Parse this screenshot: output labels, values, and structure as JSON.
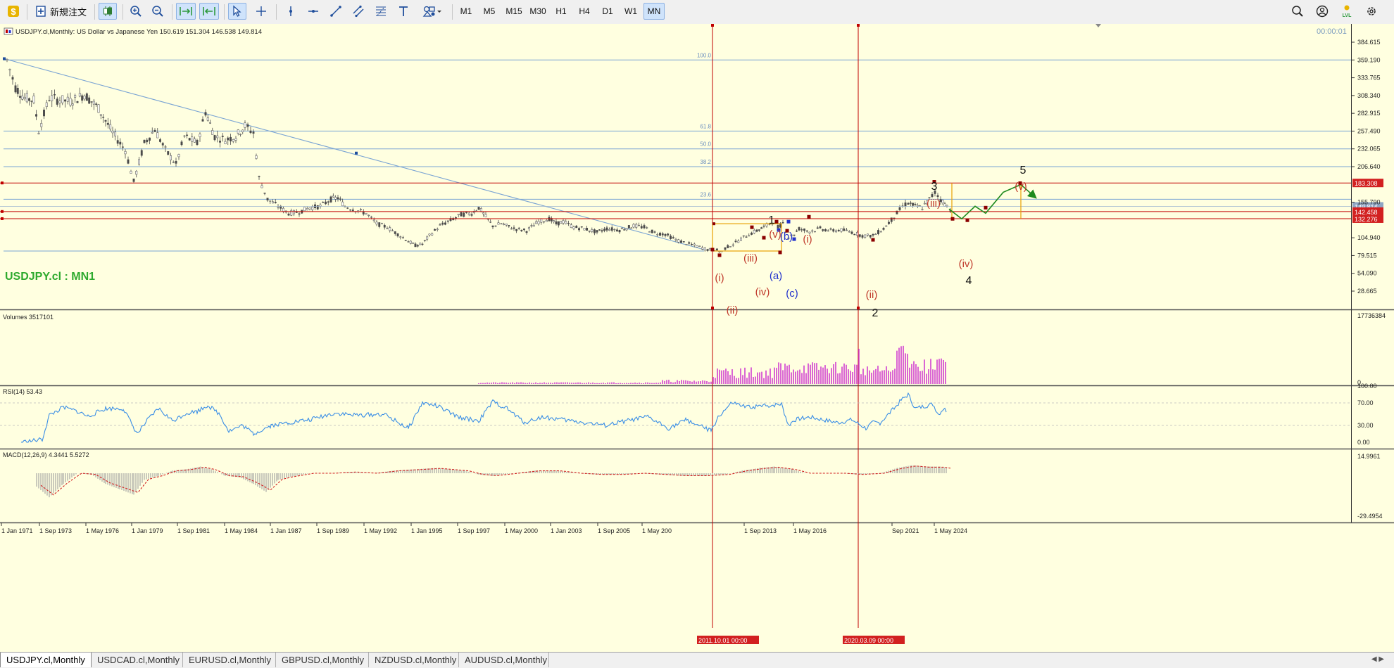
{
  "toolbar": {
    "new_order_label": "新規注文",
    "timeframes": [
      "M1",
      "M5",
      "M15",
      "M30",
      "H1",
      "H4",
      "D1",
      "W1",
      "MN"
    ],
    "active_timeframe": "MN",
    "colors": {
      "accent": "#cfe3fb",
      "app_icon": "#e8b400",
      "auto_icon": "#2e9a3e"
    }
  },
  "chart": {
    "header": "USDJPY.cl,Monthly:  US Dollar vs Japanese Yen   150.619 151.304 146.538 149.814",
    "watermark": "USDJPY.cl : MN1",
    "timer": "00:00:01",
    "price_axis": [
      "384.615",
      "359.190",
      "333.765",
      "308.340",
      "282.915",
      "257.490",
      "232.065",
      "206.640",
      "155.790",
      "104.940",
      "79.515",
      "54.090",
      "28.665"
    ],
    "price_tags": [
      "183.308",
      "149.814",
      "142.458",
      "132.276"
    ],
    "fib_levels": [
      "100.0",
      "61.8",
      "50.0",
      "38.2",
      "23.6"
    ],
    "waves": {
      "i": "(i)",
      "ii": "(ii)",
      "iii": "(iii)",
      "iv": "(iv)",
      "v": "(v)",
      "a": "(a)",
      "b": "(b)",
      "c": "(c)",
      "i2": "(i)",
      "ii2": "(ii)",
      "iii2": "(iii)",
      "iv2": "(iv)",
      "v2": "(v)",
      "n1": "1",
      "n2": "2",
      "n3": "3",
      "n4": "4",
      "n5": "5"
    },
    "volumes_label": "Volumes 3517101",
    "volumes_axis": [
      "17736384",
      "0"
    ],
    "rsi_label": "RSI(14) 53.43",
    "rsi_axis": [
      "100.00",
      "70.00",
      "30.00",
      "0.00"
    ],
    "macd_label": "MACD(12,26,9) 4.3441 5.5272",
    "macd_axis": [
      "14.9961",
      "-29.4954"
    ],
    "time_axis": [
      "1 Jan 1971",
      "1 Sep 1973",
      "1 May 1976",
      "1 Jan 1979",
      "1 Sep 1981",
      "1 May 1984",
      "1 Jan 1987",
      "1 Sep 1989",
      "1 May 1992",
      "1 Jan 1995",
      "1 Sep 1997",
      "1 May 2000",
      "1 Jan 2003",
      "1 Sep 2005",
      "1 May 200",
      "1 Sep 2013",
      "1 May 2016",
      "Sep 2021",
      "1 May 2024"
    ],
    "vline_tags": [
      "2011.10.01 00:00",
      "2020.03.09 00:00"
    ],
    "colors": {
      "background": "#ffffe0",
      "candles": "#4a4a4a",
      "red_lines": "#c00000",
      "fib_lines": "#7aa4d4",
      "rsi_line": "#3a8ee6",
      "macd_signal": "#d02020",
      "macd_hist": "#b8b8b0",
      "volumes": "#d040d0",
      "watermark": "#2eaa2e",
      "projection": "#1e8a1e",
      "rectangle": "#e8a000"
    }
  },
  "tabs": [
    "USDJPY.cl,Monthly",
    "USDCAD.cl,Monthly",
    "EURUSD.cl,Monthly",
    "GBPUSD.cl,Monthly",
    "NZDUSD.cl,Monthly",
    "AUDUSD.cl,Monthly"
  ],
  "active_tab": "USDJPY.cl,Monthly"
}
